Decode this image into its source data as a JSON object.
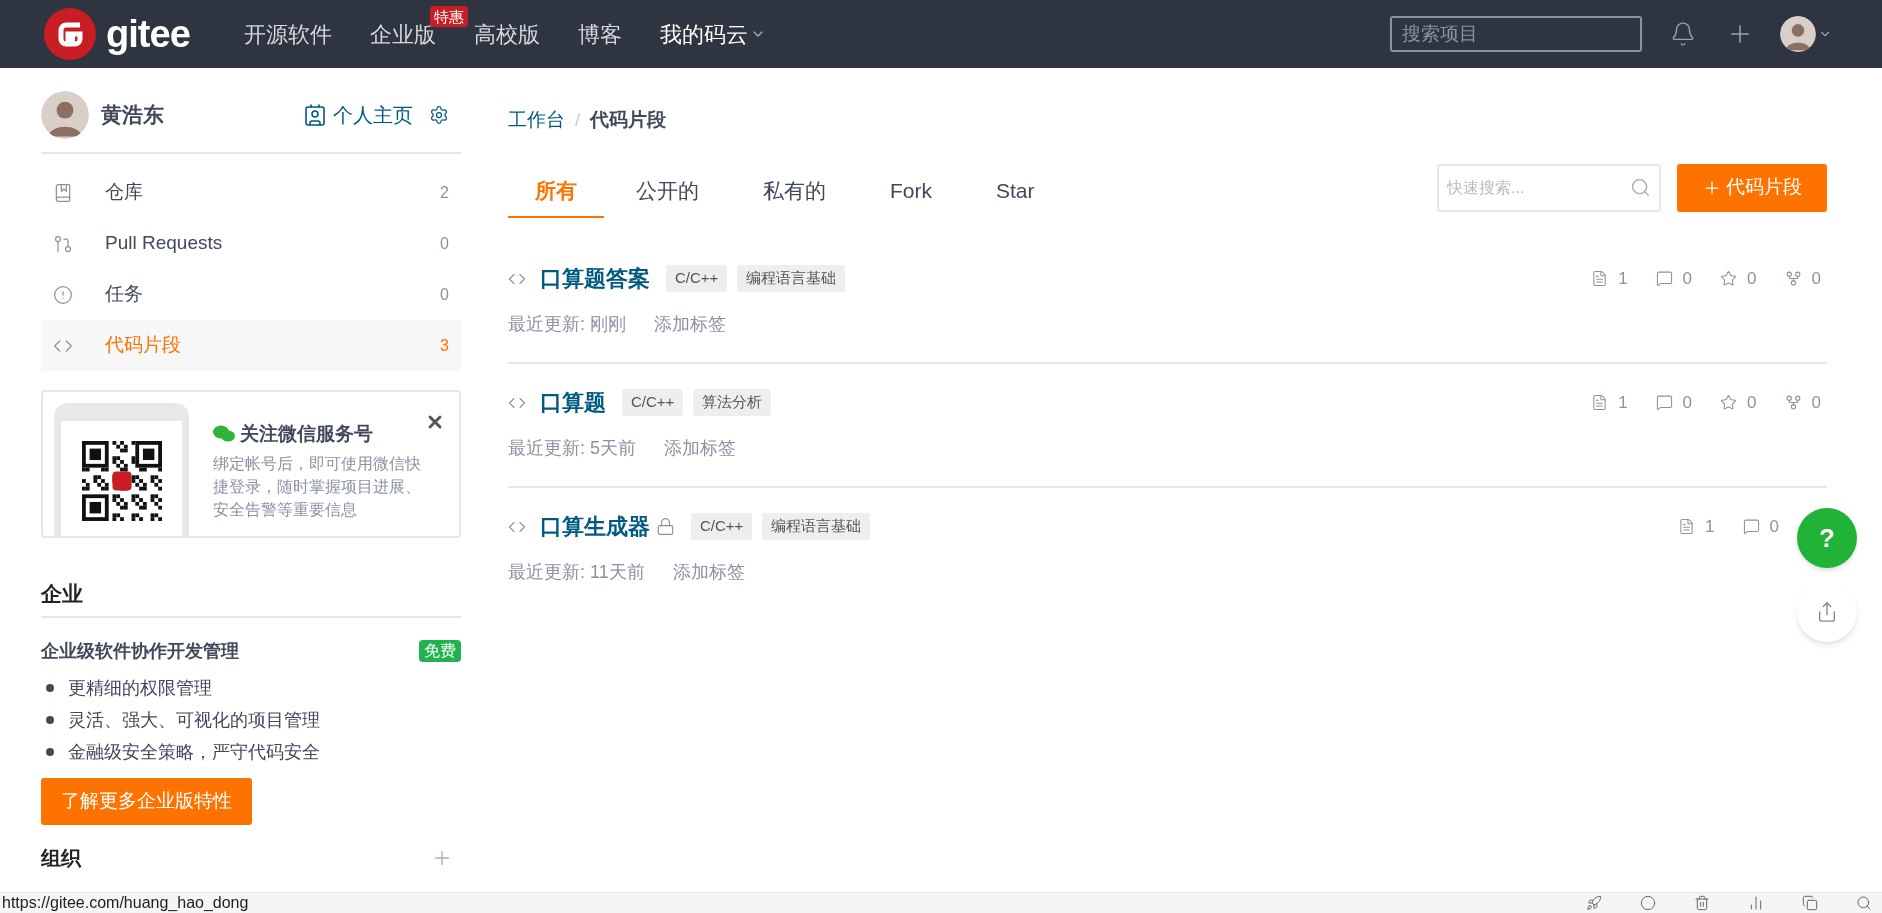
{
  "header": {
    "logo_text": "gitee",
    "nav": [
      {
        "label": "开源软件",
        "dropdown": false,
        "current": false
      },
      {
        "label": "企业版",
        "badge": "特惠",
        "dropdown": false,
        "current": false
      },
      {
        "label": "高校版",
        "dropdown": false,
        "current": false
      },
      {
        "label": "博客",
        "dropdown": false,
        "current": false
      },
      {
        "label": "我的码云",
        "dropdown": true,
        "current": true
      }
    ],
    "search": {
      "placeholder": "搜索项目"
    }
  },
  "sidebar": {
    "user": {
      "name": "黄浩东",
      "homepage_link": "个人主页"
    },
    "items": [
      {
        "kind": "repo",
        "label": "仓库",
        "count": "2",
        "selected": false
      },
      {
        "kind": "pull",
        "label": "Pull Requests",
        "count": "0",
        "selected": false
      },
      {
        "kind": "issue",
        "label": "任务",
        "count": "0",
        "selected": false
      },
      {
        "kind": "code",
        "label": "代码片段",
        "count": "3",
        "selected": true
      }
    ],
    "wechat_card": {
      "title": "关注微信服务号",
      "text": "绑定帐号后，即可使用微信快捷登录，随时掌握项目进展、安全告警等重要信息"
    },
    "enterprise": {
      "heading": "企业",
      "title": "企业级软件协作开发管理",
      "badge": "免费",
      "features": [
        "更精细的权限管理",
        "灵活、强大、可视化的项目管理",
        "金融级安全策略，严守代码安全"
      ],
      "button": "了解更多企业版特性"
    },
    "organizations": {
      "heading": "组织"
    }
  },
  "breadcrumb": {
    "items": [
      "工作台",
      "代码片段"
    ],
    "separator": "/"
  },
  "tabs": [
    {
      "label": "所有",
      "selected": true
    },
    {
      "label": "公开的",
      "selected": false
    },
    {
      "label": "私有的",
      "selected": false
    },
    {
      "label": "Fork",
      "selected": false
    },
    {
      "label": "Star",
      "selected": false
    }
  ],
  "quick_search": {
    "placeholder": "快速搜索..."
  },
  "new_button": "代码片段",
  "snippets": [
    {
      "title": "口算题答案",
      "private": false,
      "tags": [
        "C/C++",
        "编程语言基础"
      ],
      "updated": "最近更新: 刚刚",
      "add_tag": "添加标签",
      "stats": [
        {
          "kind": "file",
          "value": "1"
        },
        {
          "kind": "comment",
          "value": "0"
        },
        {
          "kind": "star",
          "value": "0"
        },
        {
          "kind": "fork",
          "value": "0"
        }
      ]
    },
    {
      "title": "口算题",
      "private": false,
      "tags": [
        "C/C++",
        "算法分析"
      ],
      "updated": "最近更新: 5天前",
      "add_tag": "添加标签",
      "stats": [
        {
          "kind": "file",
          "value": "1"
        },
        {
          "kind": "comment",
          "value": "0"
        },
        {
          "kind": "star",
          "value": "0"
        },
        {
          "kind": "fork",
          "value": "0"
        }
      ]
    },
    {
      "title": "口算生成器",
      "private": true,
      "tags": [
        "C/C++",
        "编程语言基础"
      ],
      "updated": "最近更新: 11天前",
      "add_tag": "添加标签",
      "stats": [
        {
          "kind": "file",
          "value": "1"
        },
        {
          "kind": "comment",
          "value": "0"
        }
      ]
    }
  ],
  "help_button": "?",
  "status_bar": {
    "url": "https://gitee.com/huang_hao_dong"
  }
}
